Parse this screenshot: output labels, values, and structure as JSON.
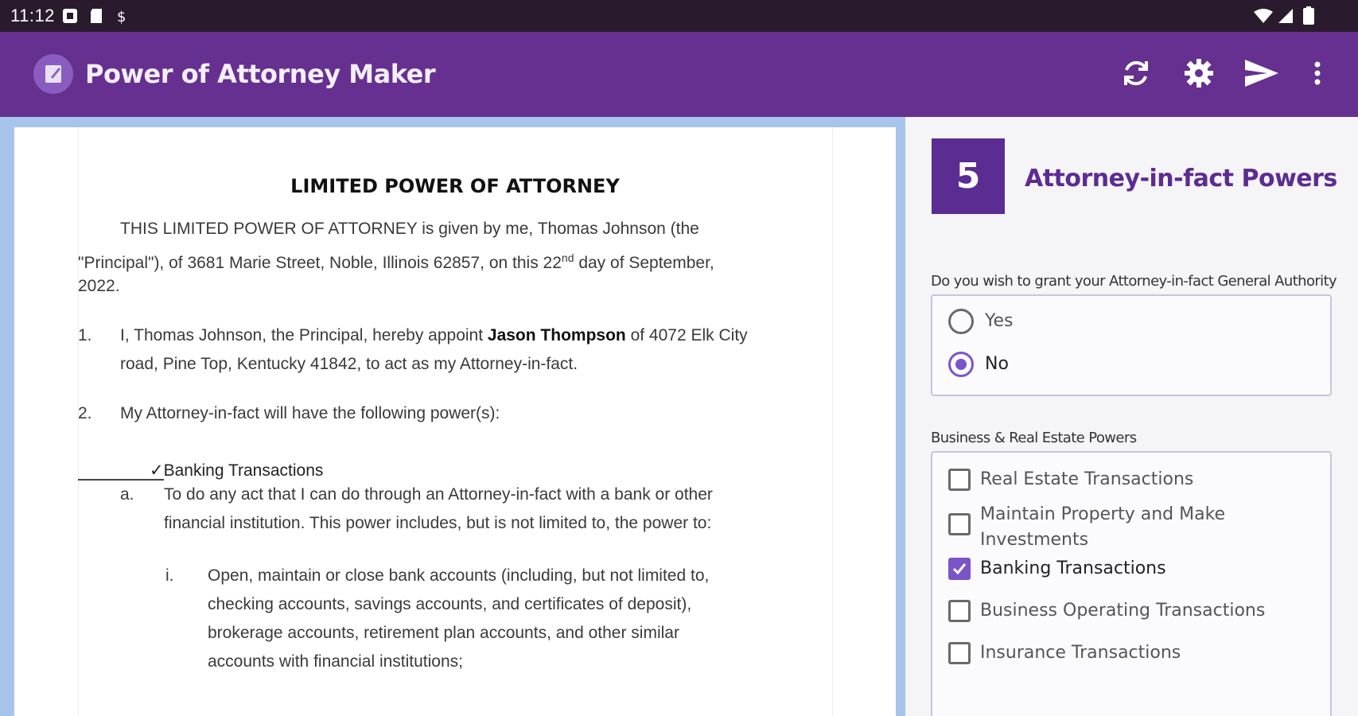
{
  "status_bar": {
    "time": "11:12",
    "left_icons": [
      "notification-icon",
      "sd-card-icon",
      "dollar-icon"
    ],
    "right_icons": [
      "wifi-icon",
      "signal-icon",
      "battery-icon"
    ]
  },
  "app_bar": {
    "title": "Power of Attorney Maker",
    "actions": [
      "refresh-icon",
      "settings-icon",
      "send-icon",
      "more-icon"
    ]
  },
  "document": {
    "title": "LIMITED POWER OF ATTORNEY",
    "intro_line1": "THIS LIMITED POWER OF ATTORNEY is given by me, Thomas Johnson (the",
    "intro_line2a": "\"Principal\"), of 3681 Marie Street, Noble, Illinois 62857, on this 22",
    "intro_sup": "nd",
    "intro_line2b": " day of September,",
    "intro_line3": "2022.",
    "item1_num": "1.",
    "item1_a": "I, Thomas Johnson, the Principal, hereby appoint ",
    "item1_name": "Jason Thompson",
    "item1_b": " of 4072 Elk City",
    "item1_line2": "road, Pine Top, Kentucky 41842, to act as my Attorney-in-fact.",
    "item2_num": "2.",
    "item2_text": "My Attorney-in-fact will have the following power(s):",
    "power_check": "✓",
    "power_heading": "Banking Transactions",
    "sub_a_num": "a.",
    "sub_a_line1": "To do any act that I can do through an Attorney-in-fact with a bank or other",
    "sub_a_line2": "financial institution. This power includes, but is not limited to, the power to:",
    "sub_i_num": "i.",
    "sub_i_line1": "Open, maintain or close bank accounts (including, but not limited to,",
    "sub_i_line2": "checking accounts, savings accounts, and certificates of deposit),",
    "sub_i_line3": "brokerage accounts, retirement plan accounts, and other similar",
    "sub_i_line4": "accounts with financial institutions;"
  },
  "panel": {
    "step_number": "5",
    "step_title": "Attorney-in-fact Powers",
    "general_authority_question": "Do you wish to grant your Attorney-in-fact General Authority",
    "radio_options": [
      {
        "label": "Yes",
        "selected": false
      },
      {
        "label": "No",
        "selected": true
      }
    ],
    "business_label": "Business & Real Estate Powers",
    "checkboxes": [
      {
        "label": "Real Estate Transactions",
        "checked": false
      },
      {
        "label": "Maintain Property and Make Investments",
        "checked": false
      },
      {
        "label": "Banking Transactions",
        "checked": true
      },
      {
        "label": "Business Operating Transactions",
        "checked": false
      },
      {
        "label": "Insurance Transactions",
        "checked": false
      }
    ]
  },
  "colors": {
    "app_bar": "#65308f",
    "accent": "#7b54c7",
    "step_box": "#5b2c91",
    "doc_background": "#a7c4ea"
  }
}
